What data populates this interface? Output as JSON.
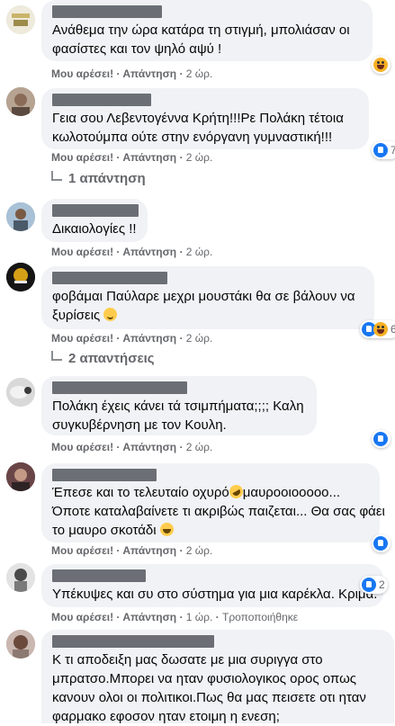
{
  "comments": [
    {
      "lines": [
        "Ανάθεμα την ώρα κατάρα τη στιγμή, μπολιάσαν οι",
        "φασίστες και τον ψηλό αψύ !"
      ],
      "like": "Μου αρέσει!",
      "reply": "Απάντηση",
      "time": "2 ώρ.",
      "reaction": {
        "icon": "haha",
        "count": ""
      }
    },
    {
      "lines": [
        "Γεια σου Λεβεντογέννα Κρήτη!!!Ρε Πολάκη τέτοια",
        "κωλοτούμπα ούτε στην ενόργανη γυμναστική!!!"
      ],
      "like": "Μου αρέσει!",
      "reply": "Απάντηση",
      "time": "2 ώρ.",
      "reaction": {
        "icon": "like",
        "count": "7"
      },
      "replies": "1 απάντηση"
    },
    {
      "lines": [
        "Δικαιολογίες !!"
      ],
      "like": "Μου αρέσει!",
      "reply": "Απάντηση",
      "time": "2 ώρ."
    },
    {
      "lines": [
        "φοβάμαι Παύλαρε μεχρι μουστάκι θα σε βάλουν να",
        "ξυρίσεις"
      ],
      "like": "Μου αρέσει!",
      "reply": "Απάντηση",
      "time": "2 ώρ.",
      "reaction": {
        "icon": "like-haha",
        "count": "6"
      },
      "replies": "2 απαντήσεις"
    },
    {
      "lines": [
        "Πολάκη έχεις κάνει τά τσιμπήματα;;;; Καλη",
        "συγκυβέρνηση με τον Κουλη."
      ],
      "like": "Μου αρέσει!",
      "reply": "Απάντηση",
      "time": "2 ώρ.",
      "reaction": {
        "icon": "like",
        "count": ""
      }
    },
    {
      "lines": [
        "Έπεσε και το τελευταίο οχυρό",
        "μαυροοιοοοοο...",
        "Όποτε καταλαβαίνετε τι ακριβώς παιζεται... Θα σας φάει",
        "το μαυρο σκοτάδι"
      ],
      "like": "Μου αρέσει!",
      "reply": "Απάντηση",
      "time": "2 ώρ.",
      "reaction": {
        "icon": "like",
        "count": ""
      }
    },
    {
      "lines": [
        "Υπέκυψες και συ στο σύστημα για μια καρέκλα. Κριμα."
      ],
      "like": "Μου αρέσει!",
      "reply": "Απάντηση",
      "time": "1 ώρ.",
      "edited": "Τροποποιήθηκε",
      "reaction": {
        "icon": "like",
        "count": "2"
      }
    },
    {
      "lines": [
        "Κ τι αποδειξη μας δωσατε με μια συριγγα στο",
        "μπρατσο.Μπορει να ηταν φυσιολογικος ορος οπως",
        "κανουν ολοι οι πολιτικοι.Πως θα μας πεισετε οτι ηταν",
        "φαρμακο εφοσον ηταν ετοιμη η ενεση;"
      ]
    }
  ]
}
